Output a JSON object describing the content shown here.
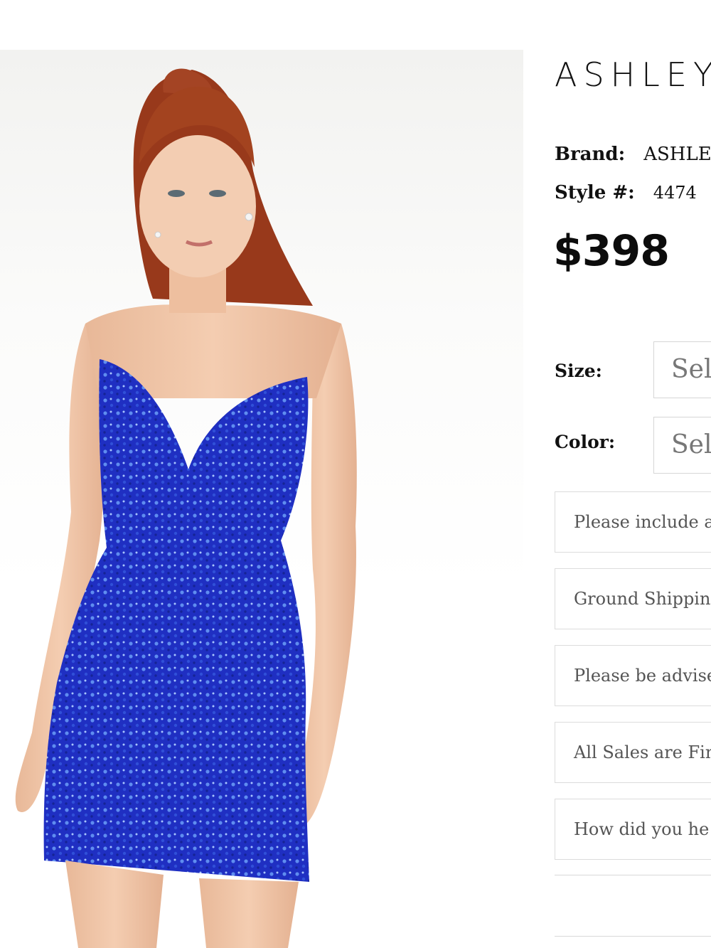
{
  "product": {
    "brand_logo": "ASHLEY",
    "brand_label": "Brand:",
    "brand_value": "ASHLEY",
    "style_label": "Style #:",
    "style_value": "4474",
    "price": "$398",
    "image_alt": "Model wearing royal blue sequin strapless mini dress"
  },
  "options": {
    "size_label": "Size:",
    "size_value": "Sele",
    "color_label": "Color:",
    "color_value": "Sele"
  },
  "notices": [
    "Please include a",
    "Ground Shippin",
    "Please be advise",
    "All Sales are Fin",
    "How did you he"
  ],
  "colors": {
    "dress": "#1f2fc2",
    "sequin_highlight": "#6f9df2",
    "hair": "#9a3a1c",
    "skin": "#f0c6a8"
  }
}
